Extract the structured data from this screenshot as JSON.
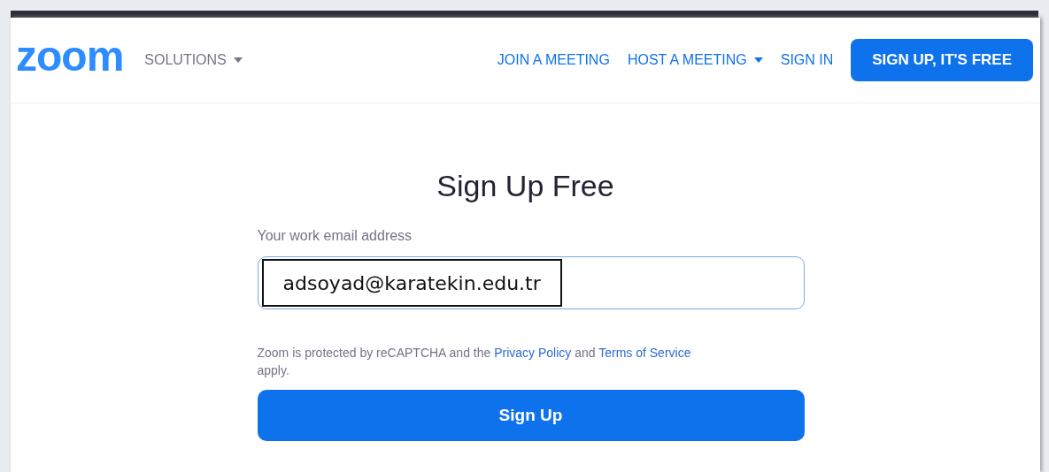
{
  "header": {
    "logo": "zoom",
    "nav": [
      {
        "label": "SOLUTIONS",
        "dropdown": true,
        "kind": "menu"
      },
      {
        "label": "JOIN A MEETING",
        "dropdown": false,
        "kind": "link"
      },
      {
        "label": "HOST A MEETING",
        "dropdown": true,
        "kind": "link"
      },
      {
        "label": "SIGN IN",
        "dropdown": false,
        "kind": "link"
      }
    ],
    "cta": "SIGN UP, IT'S FREE"
  },
  "form": {
    "title": "Sign Up Free",
    "email_label": "Your work email address",
    "email_value": "adsoyad@karatekin.edu.tr",
    "notice": [
      {
        "kind": "text",
        "text": "Zoom is protected by reCAPTCHA and the "
      },
      {
        "kind": "link",
        "text": "Privacy Policy"
      },
      {
        "kind": "text",
        "text": " and "
      },
      {
        "kind": "link",
        "text": "Terms of Service"
      },
      {
        "kind": "text",
        "text": " apply."
      }
    ],
    "submit": "Sign Up"
  }
}
